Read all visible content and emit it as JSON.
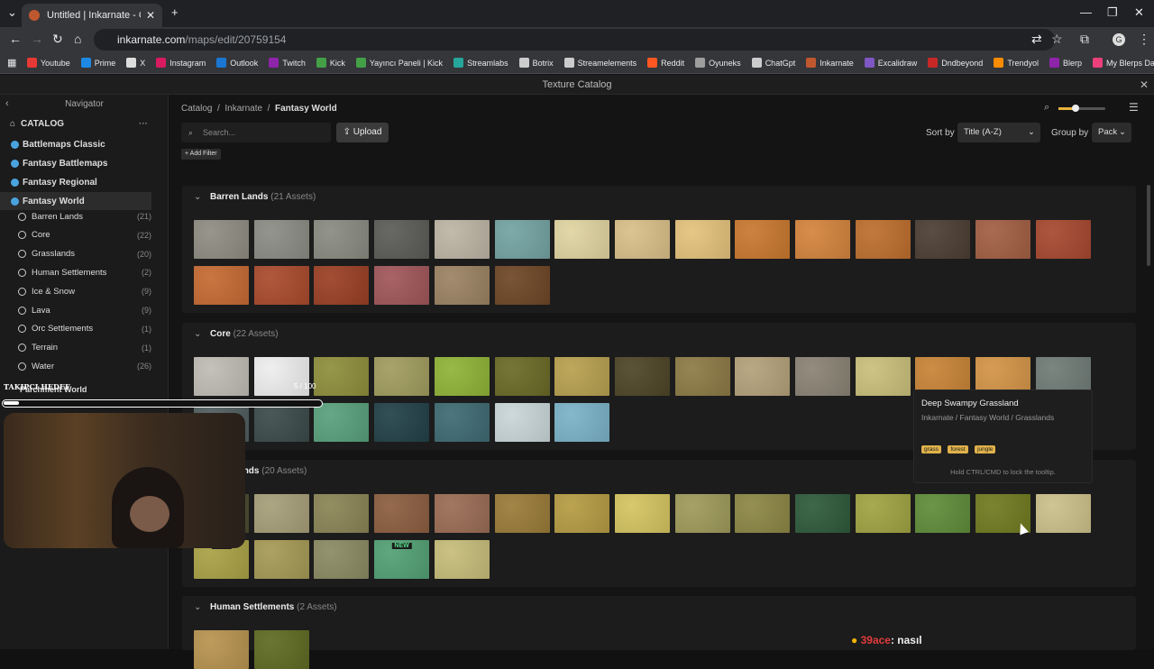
{
  "browser": {
    "tab_title": "Untitled | Inkarnate - Create Fa",
    "url_host": "inkarnate.com",
    "url_path": "/maps/edit/20759154",
    "bookmarks": [
      {
        "label": "Youtube",
        "color": "#e53935"
      },
      {
        "label": "Prime",
        "color": "#1e88e5"
      },
      {
        "label": "X",
        "color": "#dddddd"
      },
      {
        "label": "Instagram",
        "color": "#d81b60"
      },
      {
        "label": "Outlook",
        "color": "#1976d2"
      },
      {
        "label": "Twitch",
        "color": "#8e24aa"
      },
      {
        "label": "Kick",
        "color": "#43a047"
      },
      {
        "label": "Yayıncı Paneli | Kick",
        "color": "#43a047"
      },
      {
        "label": "Streamlabs",
        "color": "#26a69a"
      },
      {
        "label": "Botrix",
        "color": "#cccccc"
      },
      {
        "label": "Streamelements",
        "color": "#cccccc"
      },
      {
        "label": "Reddit",
        "color": "#ff5722"
      },
      {
        "label": "Oyuneks",
        "color": "#9e9e9e"
      },
      {
        "label": "ChatGpt",
        "color": "#cccccc"
      },
      {
        "label": "Inkarnate",
        "color": "#c0582f"
      },
      {
        "label": "Excalidraw",
        "color": "#7e57c2"
      },
      {
        "label": "Dndbeyond",
        "color": "#c62828"
      },
      {
        "label": "Trendyol",
        "color": "#fb8c00"
      },
      {
        "label": "Blerp",
        "color": "#8e24aa"
      },
      {
        "label": "My Blerps Dashboard",
        "color": "#ec407a"
      }
    ]
  },
  "app": {
    "header_title": "Texture Catalog",
    "navigator_title": "Navigator",
    "catalog_label": "CATALOG",
    "packs": [
      {
        "label": "Battlemaps Classic"
      },
      {
        "label": "Fantasy Battlemaps"
      },
      {
        "label": "Fantasy Regional"
      },
      {
        "label": "Fantasy World"
      }
    ],
    "categories": [
      {
        "label": "Barren Lands",
        "count": "(21)"
      },
      {
        "label": "Core",
        "count": "(22)"
      },
      {
        "label": "Grasslands",
        "count": "(20)"
      },
      {
        "label": "Human Settlements",
        "count": "(2)"
      },
      {
        "label": "Ice & Snow",
        "count": "(9)"
      },
      {
        "label": "Lava",
        "count": "(9)"
      },
      {
        "label": "Orc Settlements",
        "count": "(1)"
      },
      {
        "label": "Terrain",
        "count": "(1)"
      },
      {
        "label": "Water",
        "count": "(26)"
      }
    ],
    "breadcrumb": [
      "Catalog",
      "Inkarnate",
      "Fantasy World"
    ],
    "search_placeholder": "Search...",
    "upload_label": "Upload",
    "add_filter_label": "+ Add Filter",
    "sort_label": "Sort by",
    "sort_value": "Title (A-Z)",
    "group_label": "Group by",
    "group_value": "Pack",
    "new_badge": "NEW",
    "sections": [
      {
        "title": "Barren Lands",
        "count": "(21 Assets)",
        "tiles": [
          "#8f8d82",
          "#8a8c84",
          "#898b82",
          "#5b5b57",
          "#bdb4a4",
          "#74a3a3",
          "#e0d4a0",
          "#d9bf88",
          "#e4c27c",
          "#c9782f",
          "#d4843d",
          "#bd6e2d",
          "#4c3e33",
          "#a25f43",
          "#a6482f",
          "#c56a32",
          "#a94a2c",
          "#9a3f24",
          "#a0565a",
          "#9b8262",
          "#6e4626"
        ]
      },
      {
        "title": "Core",
        "count": "(22 Assets)",
        "tiles": [
          "#bfbcb4",
          "#eeeeee",
          "#8e8e3c",
          "#a09c5e",
          "#8fb337",
          "#6a6a27",
          "#b7a04f",
          "#4d4527",
          "#8c7a45",
          "#b3a17a",
          "#8a8274",
          "#c9bf7a",
          "#c88436",
          "#d39447",
          "#707b76",
          "#4f5c5e",
          "#3b4a4a",
          "#58a07c",
          "#224148",
          "#3e6a72",
          "#c9d6d8",
          "#7ab2c7"
        ]
      },
      {
        "title": "Grasslands",
        "count": "(20 Assets)",
        "tiles": [
          "#4a4a30",
          "#a69e78",
          "#8a8455",
          "#8c5e40",
          "#9a6c54",
          "#9a7b38",
          "#b59b43",
          "#d4c460",
          "#9e9a5a",
          "#8c8645",
          "#2e5a3a",
          "#a0a342",
          "#5f8c3a",
          "#6f7a1f",
          "#cbc08a",
          "#a9a145",
          "#a59a55",
          "#8a8a62",
          "#52a074",
          "#c6bd79"
        ]
      },
      {
        "title": "Human Settlements",
        "count": "(2 Assets)",
        "tiles": [
          "#b89350",
          "#5f6a22"
        ]
      }
    ],
    "tooltip": {
      "title": "Deep Swampy Grassland",
      "path": "Inkarnate / Fantasy World / Grasslands",
      "tags": [
        "grass",
        "forest",
        "jungle"
      ],
      "hint": "Hold CTRL/CMD to lock the tooltip."
    },
    "overlay": {
      "follow_label": "TAKIPCI HEDEF",
      "follow_value": "5 / 100",
      "extra_pack": "Parchment World"
    },
    "chat": {
      "user": "39ace",
      "message": ": nasıl"
    }
  }
}
